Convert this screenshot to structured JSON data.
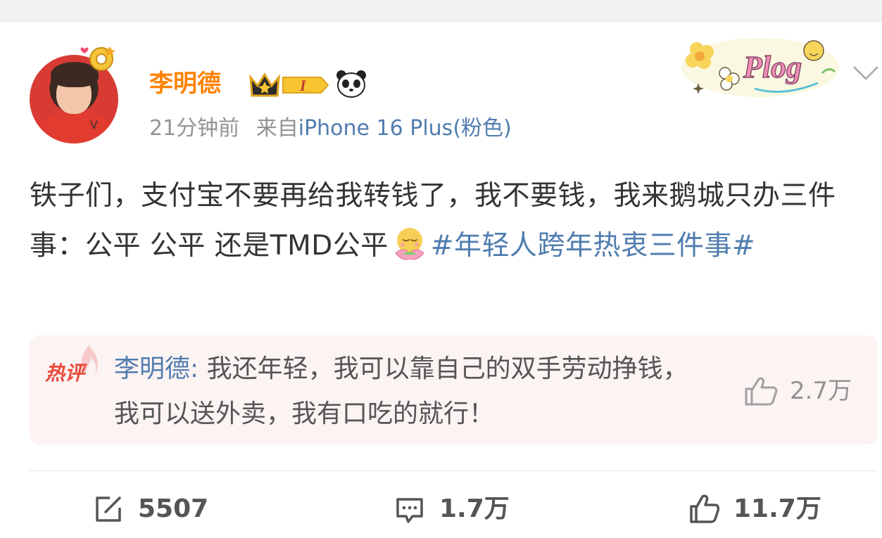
{
  "post": {
    "author": "李明德",
    "member_level": "I",
    "time": "21分钟前",
    "source_prefix": "来自",
    "source": "iPhone 16 Plus(粉色)",
    "sticker_text": "Plog",
    "content_text": "铁子们，支付宝不要再给我转钱了，我不要钱，我来鹅城只办三件事：公平 公平 还是TMD公平",
    "emoji_icon": "smiling-lotus-emoji",
    "topic": "#年轻人跨年热衷三件事#"
  },
  "hot_comment": {
    "tag": "热评",
    "author": "李明德:",
    "text": " 我还年轻，我可以靠自己的双手劳动挣钱，我可以送外卖，我有口吃的就行！",
    "likes": "2.7万"
  },
  "actions": {
    "repost_count": "5507",
    "comment_count": "1.7万",
    "like_count": "11.7万"
  },
  "colors": {
    "username": "#ff8200",
    "link": "#507daf",
    "meta": "#939393",
    "hot_comment_bg": "#fcf3f3",
    "hot_tag": "#e84a3c"
  }
}
